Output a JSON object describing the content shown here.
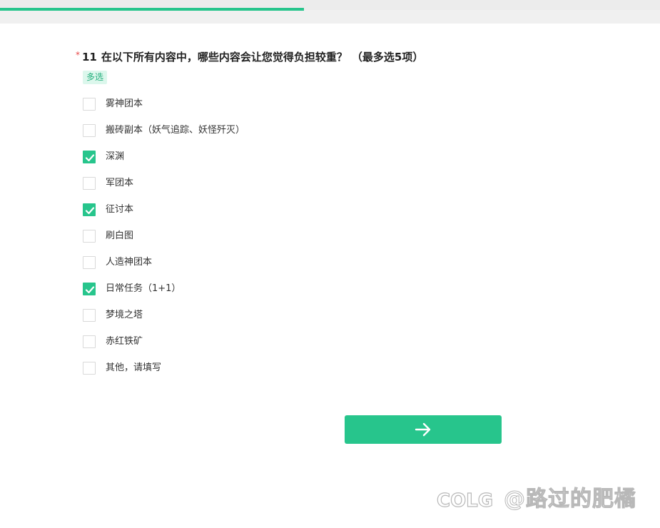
{
  "progress": {
    "fraction": 0.46,
    "color": "#27c58c"
  },
  "question": {
    "required_mark": "*",
    "number": "11",
    "title": "在以下所有内容中，哪些内容会让您觉得负担较重？",
    "limit_note": "（最多选5项）",
    "type_badge": "多选"
  },
  "options": [
    {
      "label": "雾神团本",
      "checked": false
    },
    {
      "label": "搬砖副本（妖气追踪、妖怪歼灭）",
      "checked": false
    },
    {
      "label": "深渊",
      "checked": true
    },
    {
      "label": "军团本",
      "checked": false
    },
    {
      "label": "征讨本",
      "checked": true
    },
    {
      "label": "刷白图",
      "checked": false
    },
    {
      "label": "人造神团本",
      "checked": false
    },
    {
      "label": "日常任务（1+1）",
      "checked": true
    },
    {
      "label": "梦境之塔",
      "checked": false
    },
    {
      "label": "赤红铁矿",
      "checked": false
    },
    {
      "label": "其他，请填写",
      "checked": false
    }
  ],
  "next_button": {
    "icon": "arrow-right-icon"
  },
  "watermark": {
    "logo": "COLG",
    "text": "@路过的肥橘"
  },
  "colors": {
    "accent": "#27c58c",
    "required": "#e84848",
    "badge_bg": "#dcf7ec"
  }
}
